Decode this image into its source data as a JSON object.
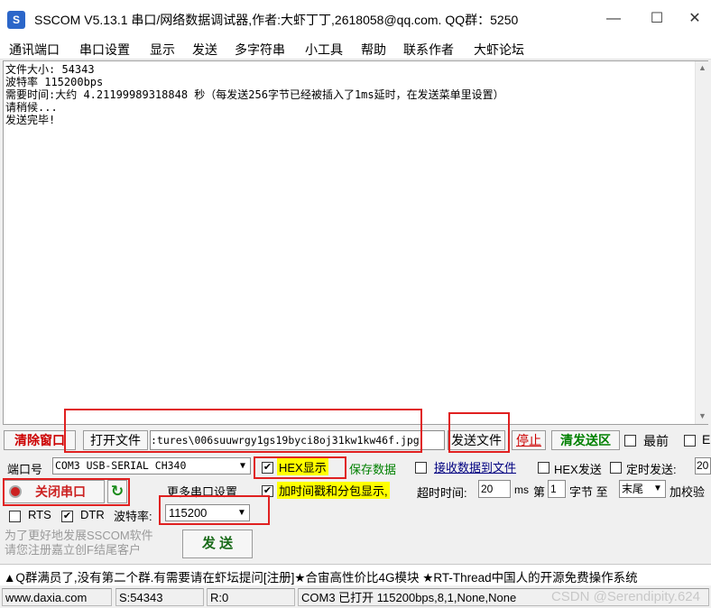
{
  "window": {
    "title": "SSCOM V5.13.1 串口/网络数据调试器,作者:大虾丁丁,2618058@qq.com. QQ群：5250",
    "minimize_glyph": "—",
    "maximize_glyph": "☐",
    "close_glyph": "✕"
  },
  "menu": [
    "通讯端口",
    "串口设置",
    "显示",
    "发送",
    "多字符串",
    "小工具",
    "帮助",
    "联系作者",
    "大虾论坛"
  ],
  "receive_area": {
    "lines": [
      "文件大小: 54343",
      "波特率 115200bps",
      "需要时间:大约 4.21199989318848 秒（每发送256字节已经被插入了1ms延时，在发送菜单里设置）",
      "请稍候...",
      "发送完毕!"
    ]
  },
  "toolbar": {
    "clear_window": "清除窗口",
    "open_file": "打开文件",
    "file_path": ":tures\\006suuwrgy1gs19byci8oj31kw1kw46f.jpg",
    "send_file": "发送文件",
    "stop": "停止",
    "clear_send_area": "清发送区",
    "topmost": "最前",
    "topmost_checked": false,
    "english": "E",
    "english_checked": false
  },
  "port_row": {
    "port_label": "端口号",
    "port_value": "COM3 USB-SERIAL CH340",
    "hex_display_label": "HEX显示",
    "hex_display_checked": true,
    "save_data": "保存数据",
    "recv_to_file_label": "接收数据到文件",
    "recv_to_file_checked": false,
    "hex_send_label": "HEX发送",
    "hex_send_checked": false,
    "timed_send_label": "定时发送:",
    "timed_send_checked": false,
    "timed_send_value": "20"
  },
  "control_row": {
    "close_port": "关闭串口",
    "more_settings": "更多串口设置",
    "timestamp_label": "加时间戳和分包显示,",
    "timestamp_checked": true,
    "timeout_label": "超时时间:",
    "timeout_value": "20",
    "timeout_unit": "ms",
    "nth_label": "第",
    "nth_value": "1",
    "byte_label": "字节 至",
    "tail_value": "末尾",
    "checksum_label": "加校验"
  },
  "signal_row": {
    "rts_label": "RTS",
    "rts_checked": false,
    "dtr_label": "DTR",
    "dtr_checked": true,
    "baud_label": "波特率:",
    "baud_value": "115200"
  },
  "promo": {
    "line1": "为了更好地发展SSCOM软件",
    "line2": "请您注册嘉立创F结尾客户",
    "send_button": "发  送"
  },
  "marquee": "▲Q群满员了,没有第二个群.有需要请在虾坛提问[注册]★合宙高性价比4G模块 ★RT-Thread中国人的开源免费操作系统",
  "status": {
    "website": "www.daxia.com",
    "sent": "S:54343",
    "received": "R:0",
    "port_status": "COM3 已打开  115200bps,8,1,None,None"
  },
  "watermark": "CSDN @Serendipity.624",
  "colors": {
    "hex_highlight": "#ffff00",
    "link_green": "#008000",
    "annotation_red": "#e02020",
    "stop_red": "#cc0000",
    "port_icon_red": "#cc2222"
  }
}
